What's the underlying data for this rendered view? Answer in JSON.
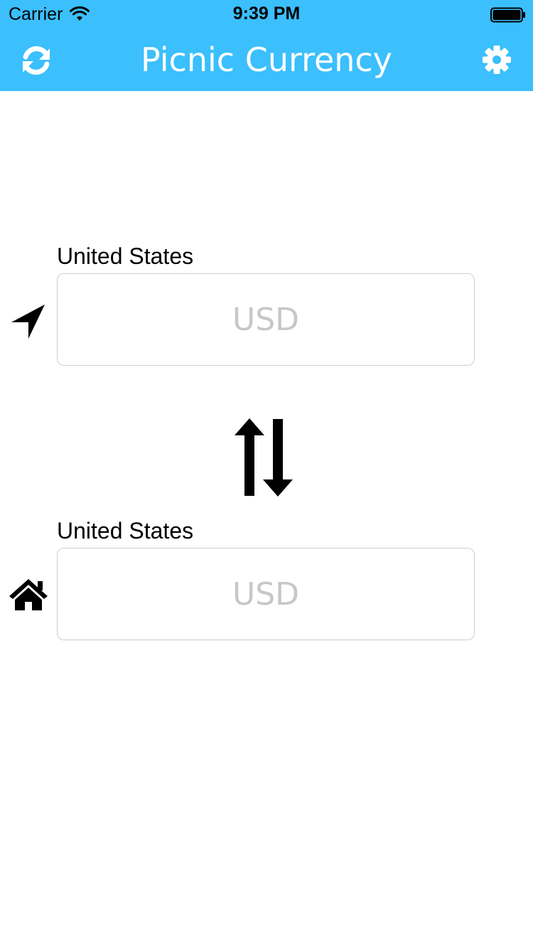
{
  "status_bar": {
    "carrier": "Carrier",
    "time": "9:39 PM",
    "wifi_icon": "wifi-icon",
    "battery_icon": "battery-icon"
  },
  "nav": {
    "title": "Picnic Currency",
    "left_icon": "refresh-icon",
    "right_icon": "gear-icon",
    "background_color": "#3bbffd"
  },
  "from": {
    "icon": "location-arrow-icon",
    "country": "United States",
    "placeholder": "USD"
  },
  "swap": {
    "icon": "swap-arrows-icon"
  },
  "to": {
    "icon": "home-icon",
    "country": "United States",
    "placeholder": "USD"
  }
}
